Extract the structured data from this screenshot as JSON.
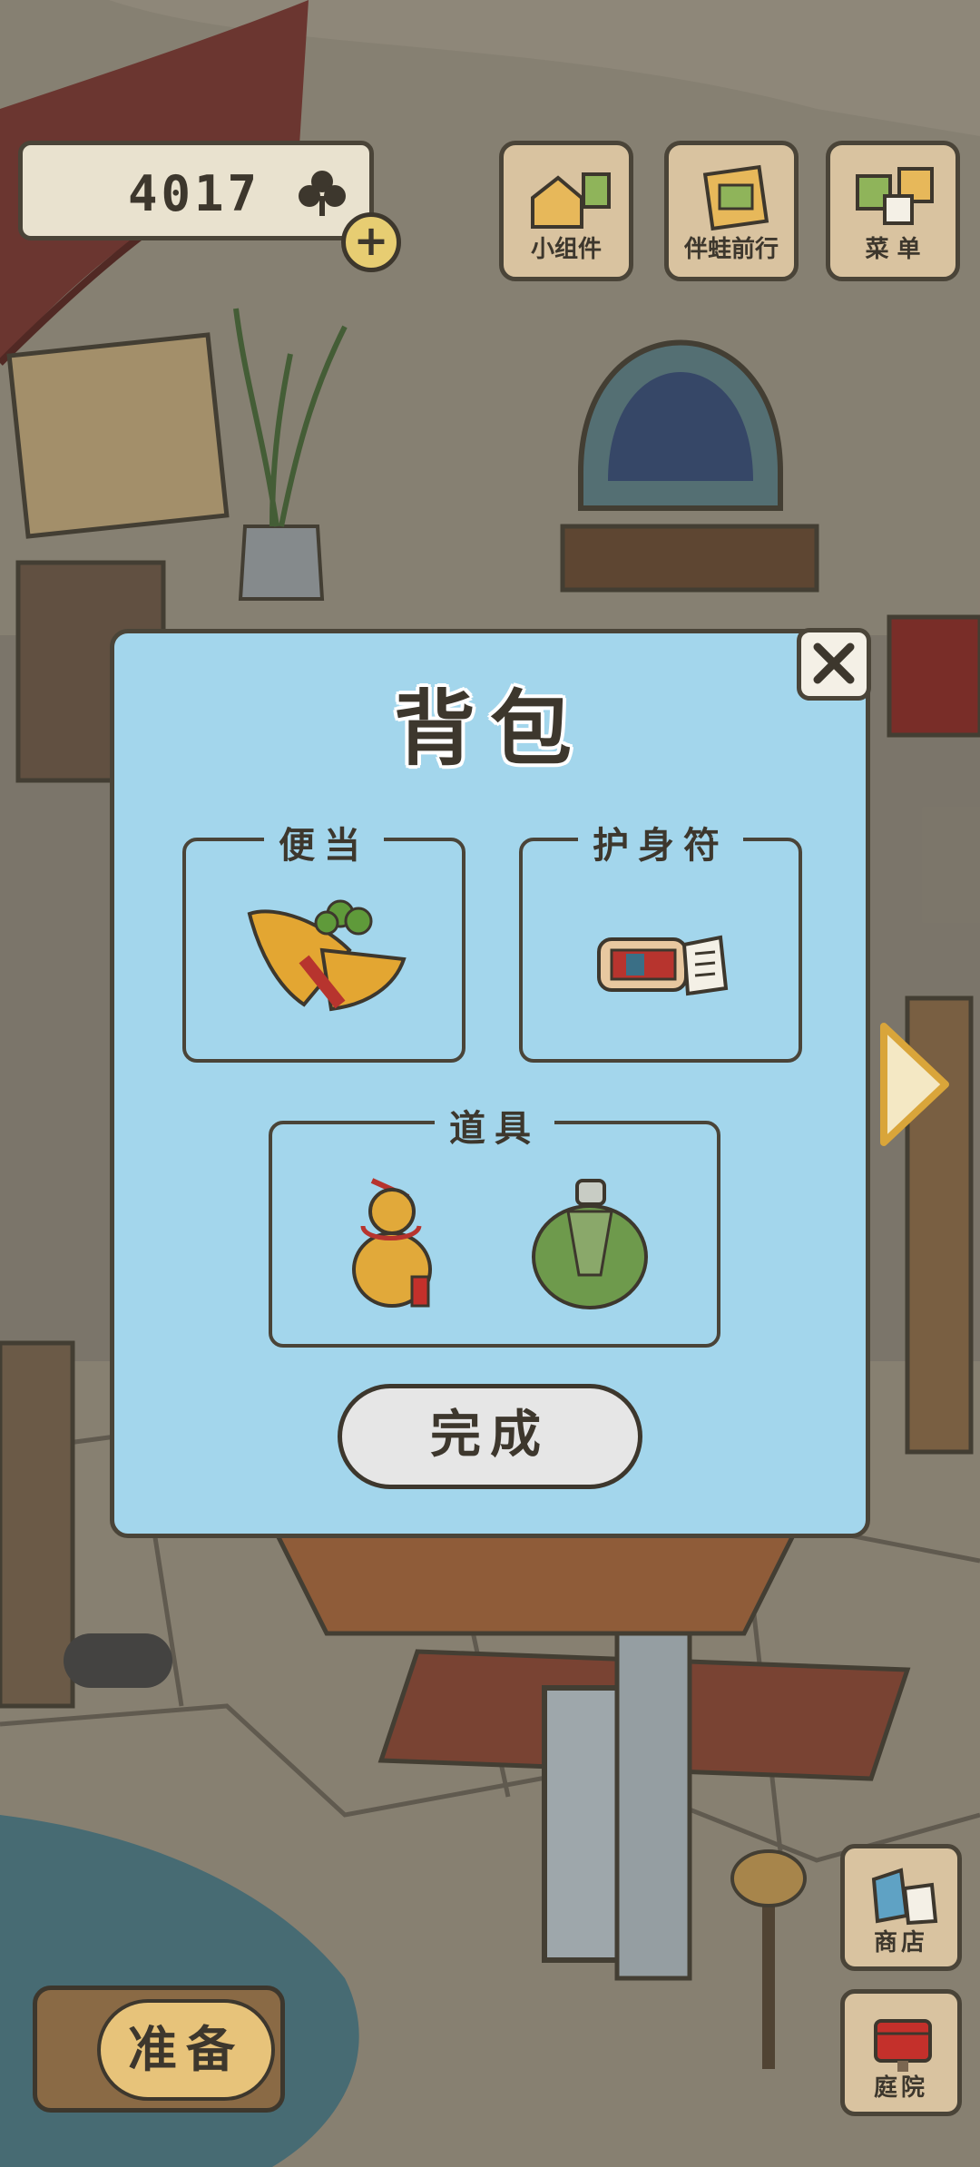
{
  "hud": {
    "clover_count": "4017",
    "plus_label": "+",
    "buttons": [
      {
        "label": "小组件",
        "icon": "widget-icon"
      },
      {
        "label": "伴蛙前行",
        "icon": "frog-journey-icon"
      },
      {
        "label": "菜 单",
        "icon": "menu-icon"
      }
    ]
  },
  "dialog": {
    "title": "背包",
    "close_label": "✕",
    "slots": [
      {
        "label": "便当",
        "items": [
          "bento-item-icon"
        ]
      },
      {
        "label": "护身符",
        "items": [
          "charm-item-icon"
        ]
      },
      {
        "label": "道具",
        "items": [
          "gourd-item-icon",
          "canteen-item-icon"
        ]
      }
    ],
    "done_label": "完成"
  },
  "bottom": {
    "ready_label": "准备",
    "shop_label": "商店",
    "yard_label": "庭院"
  },
  "colors": {
    "dialog_bg": "#a3d6ec",
    "outline": "#4a4438",
    "button_wood": "#d9c3a0",
    "done_bg": "#e6e6e6"
  }
}
